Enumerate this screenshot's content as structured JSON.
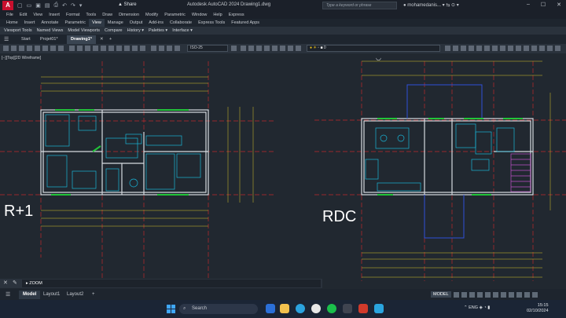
{
  "app": {
    "logo_letter": "A",
    "share_label": "Share",
    "window_title": "Autodesk AutoCAD 2024   Drawing1.dwg",
    "search_placeholder": "Type a keyword or phrase",
    "user_name": "mohamedanis..."
  },
  "menubar": [
    "File",
    "Edit",
    "View",
    "Insert",
    "Format",
    "Tools",
    "Draw",
    "Dimension",
    "Modify",
    "Parametric",
    "Window",
    "Help",
    "Express"
  ],
  "ribbon_tabs": [
    "Home",
    "Insert",
    "Annotate",
    "Parametric",
    "View",
    "Manage",
    "Output",
    "Add-ins",
    "Collaborate",
    "Express Tools",
    "Featured Apps"
  ],
  "ribbon_active": "View",
  "ribbon_panels": [
    "Viewport Tools",
    "Named Views",
    "Model Viewports",
    "Compare",
    "History ▾",
    "Palettes ▾",
    "Interface ▾"
  ],
  "doc_tabs": [
    "Start",
    "Projet01*",
    "Drawing1*"
  ],
  "doc_tab_active": "Drawing1*",
  "toolbar": {
    "dimstyle": "ISO-25",
    "layer": "0"
  },
  "viewport_label": "[−][Top][2D Wireframe]",
  "drawing_labels": {
    "left_plan": "R+1",
    "right_plan": "RDC"
  },
  "command_line": {
    "value": "ZOOM"
  },
  "layout_tabs": [
    "Model",
    "Layout1",
    "Layout2"
  ],
  "layout_active": "Model",
  "status_bar": {
    "mode": "MODEL"
  },
  "taskbar": {
    "search_label": "Search",
    "language": "ENG",
    "time": "15:15",
    "date": "02/10/2024"
  },
  "colors": {
    "canvas": "#212830",
    "wall": "#d6dbe0",
    "furniture": "#19b5d8",
    "axis": "#c0282b",
    "window": "#22c53a",
    "dimension": "#e8d52a",
    "stair": "#c050c8",
    "canopy": "#3050d8"
  }
}
